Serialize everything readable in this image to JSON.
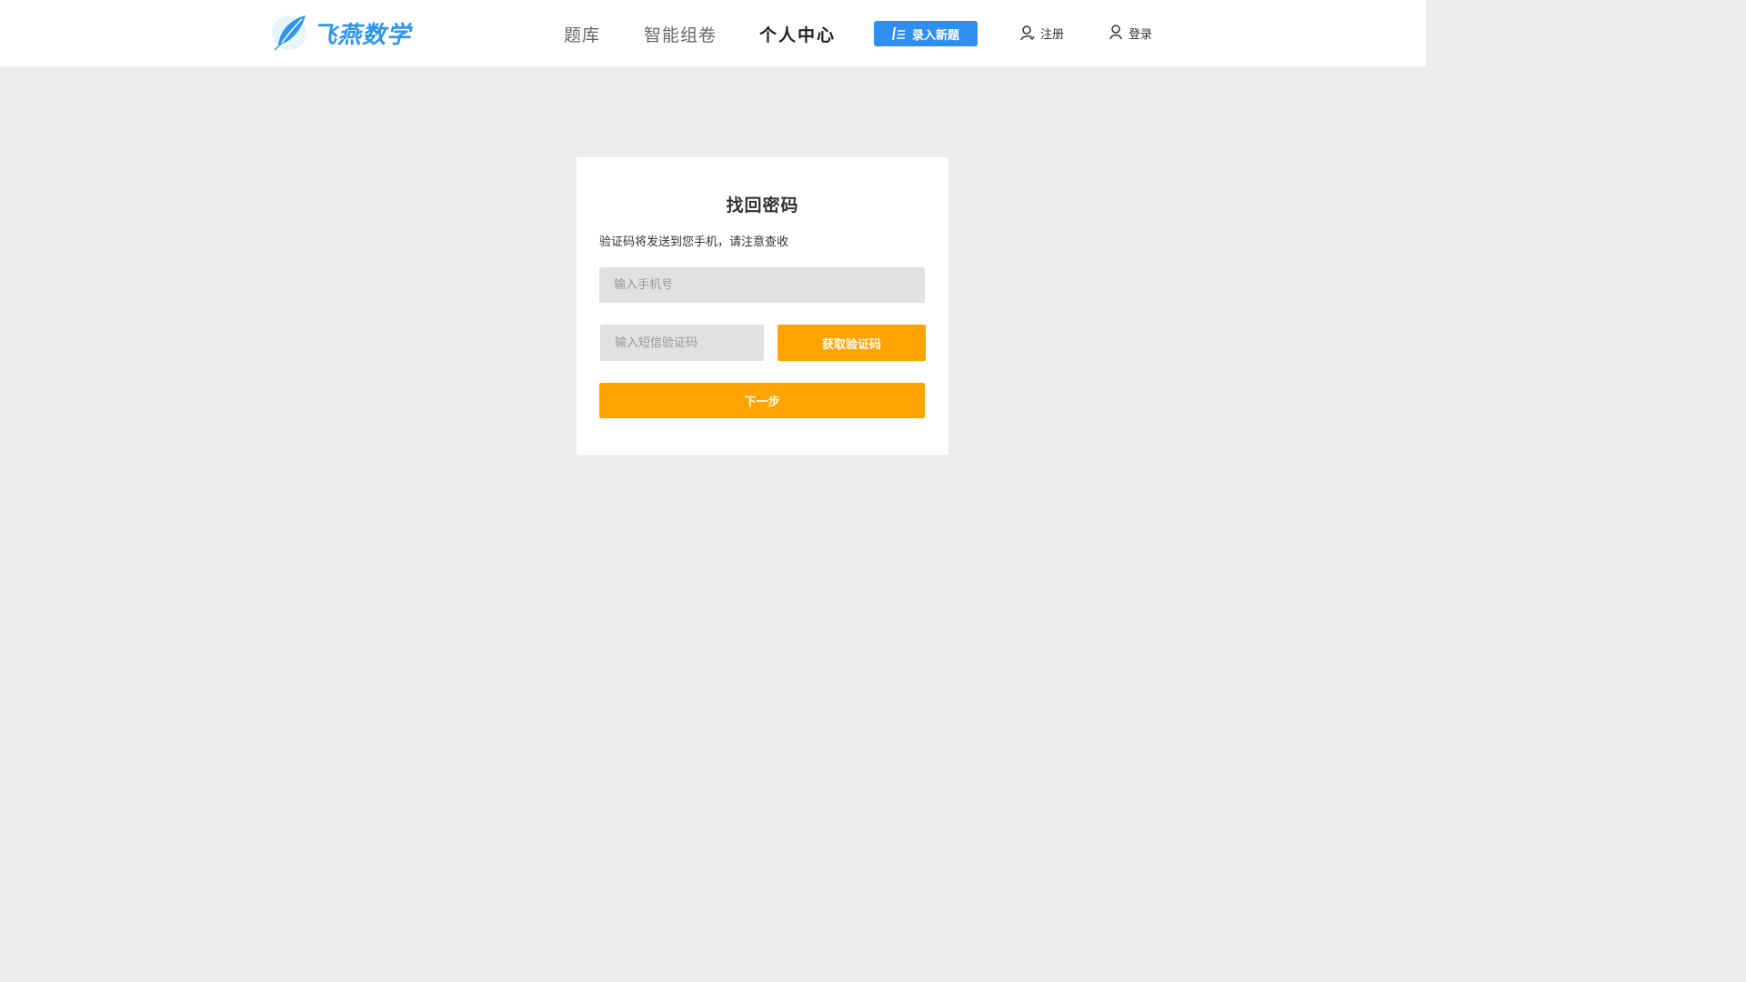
{
  "header": {
    "logo_text": "飞燕数学",
    "nav": [
      {
        "label": "题库"
      },
      {
        "label": "智能组卷"
      },
      {
        "label": "个人中心",
        "active": true
      }
    ],
    "new_question_label": "录入新题",
    "register_label": "注册",
    "login_label": "登录"
  },
  "recover": {
    "title": "找回密码",
    "hint": "验证码将发送到您手机，请注意查收",
    "phone_placeholder": "输入手机号",
    "code_placeholder": "输入短信验证码",
    "get_code_label": "获取验证码",
    "next_label": "下一步"
  },
  "colors": {
    "brand_blue": "#2e8ff0",
    "accent_orange": "#ffa300",
    "page_bg": "#ededed"
  },
  "icons": {
    "logo": "leaf-feather-icon",
    "new_question": "edit-list-icon",
    "register": "user-add-icon",
    "login": "user-icon"
  }
}
